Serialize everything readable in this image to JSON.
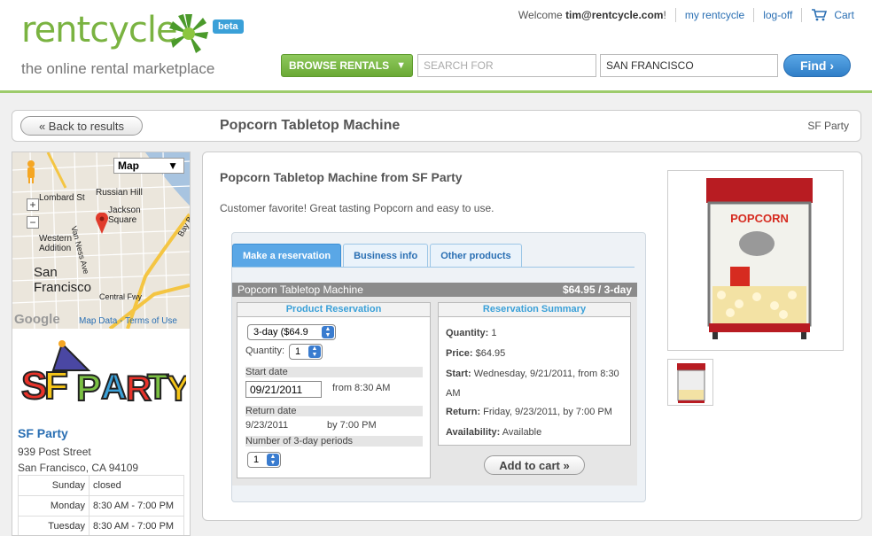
{
  "header": {
    "logo_word": "rentcycle",
    "logo_tagline": "the online rental marketplace",
    "beta": "beta",
    "welcome_prefix": "Welcome ",
    "user": "tim@rentcycle.com",
    "welcome_suffix": "!",
    "my_rentcycle": "my rentcycle",
    "logoff": "log-off",
    "cart": "Cart",
    "browse": "BROWSE RENTALS",
    "search_placeholder": "SEARCH FOR",
    "city_value": "SAN FRANCISCO",
    "find": "Find"
  },
  "titlebar": {
    "back": "« Back to results",
    "title": "Popcorn Tabletop Machine",
    "vendor": "SF Party"
  },
  "sidebar": {
    "map": {
      "select": "Map",
      "labels": [
        "Lombard St",
        "Russian Hill",
        "Jackson Square",
        "Van Ness Ave",
        "Western Addition",
        "San Francisco",
        "Central Fwy",
        "Bay Bridge"
      ],
      "google": "Google",
      "map_data": "Map Data",
      "terms": "Terms of Use"
    },
    "vendor_name": "SF Party",
    "address1": "939 Post Street",
    "address2": "San Francisco, CA 94109",
    "hours": [
      {
        "day": "Sunday",
        "time": "closed"
      },
      {
        "day": "Monday",
        "time": "8:30 AM - 7:00 PM"
      },
      {
        "day": "Tuesday",
        "time": "8:30 AM - 7:00 PM"
      }
    ]
  },
  "main": {
    "heading": "Popcorn Tabletop Machine from SF Party",
    "description": "Customer favorite! Great tasting Popcorn and easy to use.",
    "tabs": [
      "Make a reservation",
      "Business info",
      "Other products"
    ],
    "product_bar": {
      "name": "Popcorn Tabletop Machine",
      "price": "$64.95 / 3-day"
    },
    "reservation": {
      "title": "Product Reservation",
      "period_select": "3-day ($64.9",
      "quantity_label": "Quantity:",
      "quantity_value": "1",
      "start_label": "Start date",
      "start_value": "09/21/2011",
      "start_from": "from 8:30 AM",
      "return_label": "Return date",
      "return_value": "9/23/2011",
      "return_by": "by 7:00 PM",
      "periods_label": "Number of 3-day periods",
      "periods_value": "1"
    },
    "summary": {
      "title": "Reservation Summary",
      "quantity_label": "Quantity:",
      "quantity": "1",
      "price_label": "Price:",
      "price": "$64.95",
      "start_label": "Start:",
      "start": "Wednesday, 9/21/2011, from 8:30 AM",
      "return_label": "Return:",
      "return": "Friday, 9/23/2011, by 7:00 PM",
      "availability_label": "Availability:",
      "availability": "Available"
    },
    "add_to_cart": "Add to cart »",
    "photo_sign": "POPCORN"
  },
  "colors": {
    "brand_green": "#7ab341",
    "link_blue": "#2a6fb3",
    "tab_blue": "#5aa7e6"
  }
}
